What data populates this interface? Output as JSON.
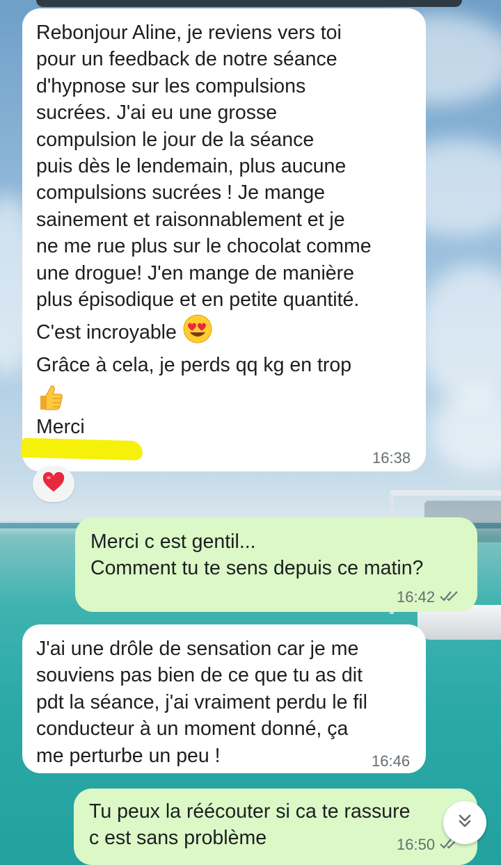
{
  "messages": [
    {
      "direction": "incoming",
      "paragraphs": [
        "Rebonjour Aline, je reviens vers toi\npour un feedback de notre séance\nd'hypnose sur les compulsions\nsucrées. J'ai eu une grosse\ncompulsion le jour de la séance\npuis dès le lendemain, plus aucune\ncompulsions sucrées ! Je mange\nsainement et raisonnablement et je\nne me rue plus sur le chocolat comme\nune drogue! J'en mange de manière\nplus épisodique et en petite quantité.",
        "C'est incroyable",
        "Grâce à cela, je perds qq kg en trop",
        "Merci"
      ],
      "time": "16:38",
      "reaction": "heart"
    },
    {
      "direction": "outgoing",
      "text": "Merci c est gentil...\nComment tu te sens depuis ce matin?",
      "time": "16:42",
      "status": "read"
    },
    {
      "direction": "incoming",
      "text": "J'ai une drôle de sensation car je me\nsouviens pas bien de ce que tu as dit\npdt la séance, j'ai vraiment perdu le fil\nconducteur à un moment donné, ça\nme perturbe un peu !",
      "time": "16:46"
    },
    {
      "direction": "outgoing",
      "text": "Tu peux la réécouter si ca te rassure\nc est sans problème",
      "time": "16:50",
      "status": "read"
    }
  ],
  "icons": {
    "reaction": "heart-icon",
    "scroll": "chevron-double-down-icon",
    "status": "double-check-icon"
  },
  "colors": {
    "incoming_bubble": "#ffffff",
    "outgoing_bubble": "#dcf8c6",
    "heart": "#e8283f",
    "highlight": "#f6f10a"
  }
}
